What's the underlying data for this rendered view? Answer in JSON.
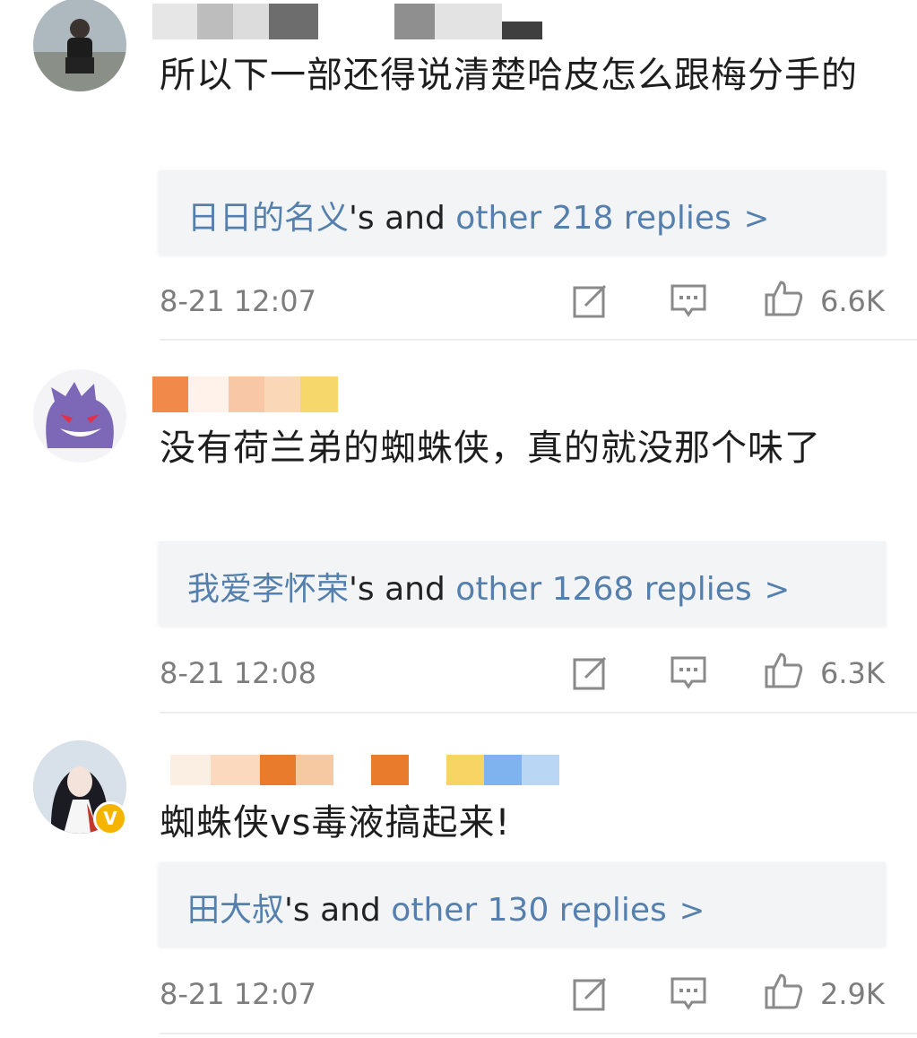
{
  "comments": [
    {
      "text": "所以下一部还得说清楚哈皮怎么跟梅分手的",
      "replies": {
        "user": "日日的名义",
        "connector": "'s and",
        "rest": "other 218 replies",
        "chevron": ">"
      },
      "time": "8-21 12:07",
      "likes": "6.6K"
    },
    {
      "text": "没有荷兰弟的蜘蛛侠，真的就没那个味了",
      "replies": {
        "user": "我爱李怀荣",
        "connector": "'s and",
        "rest": "other 1268 replies",
        "chevron": ">"
      },
      "time": "8-21 12:08",
      "likes": "6.3K"
    },
    {
      "text": "蜘蛛侠vs毒液搞起来!",
      "replies": {
        "user": "田大叔",
        "connector": "'s and",
        "rest": "other 130 replies",
        "chevron": ">"
      },
      "time": "8-21 12:07",
      "likes": "2.9K"
    }
  ],
  "colors": {
    "link": "#5580ad",
    "meta": "#7d7d7d",
    "badge": "#f4b400"
  },
  "icons": [
    "share-icon",
    "comment-icon",
    "like-icon",
    "verified-badge-icon"
  ]
}
